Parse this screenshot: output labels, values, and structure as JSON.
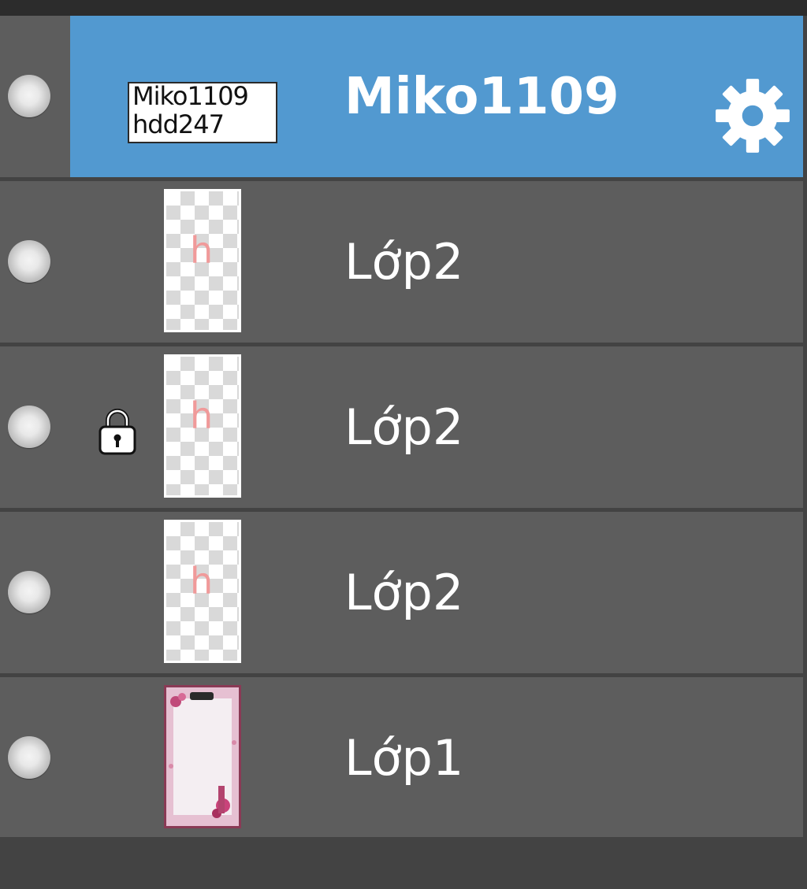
{
  "layers_panel": {
    "layers": [
      {
        "name": "Miko1109",
        "thumbnail_text_line1": "Miko1109",
        "thumbnail_text_line2": "hdd247",
        "selected": true,
        "locked": false,
        "thumbnail_type": "text"
      },
      {
        "name": "Lớp2",
        "thumbnail_glyph": "h",
        "selected": false,
        "locked": false,
        "thumbnail_type": "transparent"
      },
      {
        "name": "Lớp2",
        "thumbnail_glyph": "h",
        "selected": false,
        "locked": true,
        "thumbnail_type": "transparent"
      },
      {
        "name": "Lớp2",
        "thumbnail_glyph": "h",
        "selected": false,
        "locked": false,
        "thumbnail_type": "transparent"
      },
      {
        "name": "Lớp1",
        "selected": false,
        "locked": false,
        "thumbnail_type": "image"
      }
    ],
    "icons": {
      "visibility": "visibility-dot-icon",
      "lock": "lock-icon",
      "settings": "gear-icon"
    },
    "colors": {
      "panel_bg": "#434343",
      "row_bg": "#5d5d5d",
      "selected_bg": "#5299d0",
      "text": "#ffffff",
      "glyph_pink": "#f09a9a"
    }
  }
}
